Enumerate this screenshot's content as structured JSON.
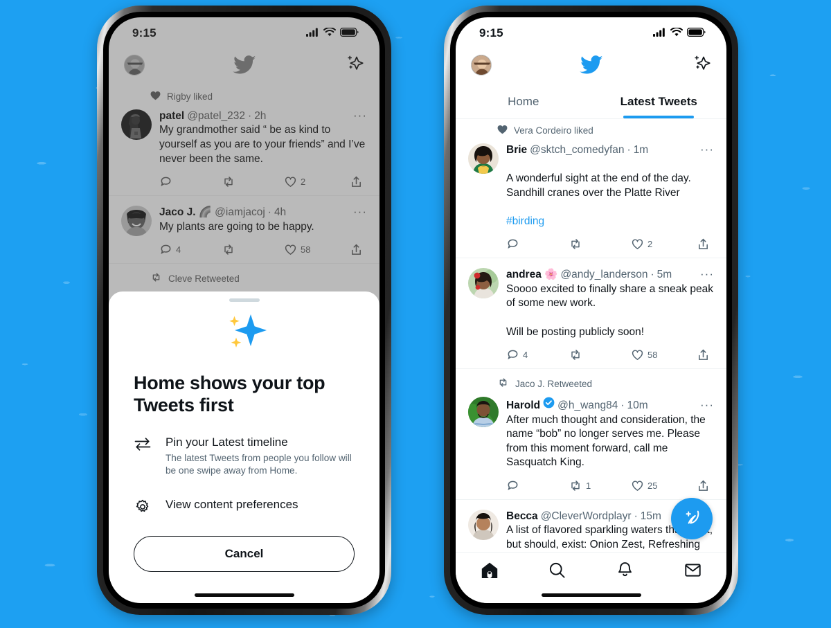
{
  "background": {
    "color": "#1DA0F2"
  },
  "phone_left": {
    "status_bar": {
      "time": "9:15",
      "icons": [
        "cellular-signal-icon",
        "wifi-icon",
        "battery-icon"
      ]
    },
    "app_bar": {
      "avatar": "profile-avatar",
      "logo": "twitter-bird-logo",
      "action": "sparkle-icon"
    },
    "timeline": [
      {
        "context_icon": "heart-filled-icon",
        "context": "Rigby liked",
        "name": "patel",
        "handle": "@patel_232",
        "separator": "·",
        "time": "2h",
        "text": "My grandmother said “ be as kind to yourself as you are to your friends” and I’ve never been the same.",
        "reply": "",
        "retweet": "",
        "like": "2",
        "more": "···"
      },
      {
        "context_icon": "",
        "context": "",
        "name": "Jaco J. 🌈",
        "handle": "@iamjacoj",
        "separator": "·",
        "time": "4h",
        "text": "My plants are going to be happy.",
        "reply": "4",
        "retweet": "",
        "like": "58",
        "more": "···"
      }
    ],
    "partial_context": {
      "icon": "retweet-icon",
      "label": "Cleve Retweeted"
    },
    "sheet": {
      "illustration": "sparkles-illustration",
      "title": "Home shows your top Tweets first",
      "rows": [
        {
          "icon": "swap-arrows-icon",
          "title": "Pin your Latest timeline",
          "subtitle": "The latest Tweets from people you follow will be one swipe away from Home."
        },
        {
          "icon": "gear-icon",
          "title": "View content preferences",
          "subtitle": ""
        }
      ],
      "cancel_label": "Cancel"
    }
  },
  "phone_right": {
    "status_bar": {
      "time": "9:15",
      "icons": [
        "cellular-signal-icon",
        "wifi-icon",
        "battery-icon"
      ]
    },
    "app_bar": {
      "avatar": "profile-avatar",
      "logo": "twitter-bird-logo",
      "action": "sparkle-icon"
    },
    "tabs": [
      {
        "label": "Home",
        "active": false
      },
      {
        "label": "Latest Tweets",
        "active": true
      }
    ],
    "accent_color": "#1D9BF0",
    "timeline": [
      {
        "context_icon": "heart-filled-icon",
        "context": "Vera Cordeiro liked",
        "name": "Brie",
        "verified": false,
        "handle": "@sktch_comedyfan",
        "separator": "·",
        "time": "1m",
        "text": "A wonderful sight at the end of the day. Sandhill cranes over the Platte River ",
        "hashtag": "#birding",
        "reply": "",
        "retweet": "",
        "like": "2",
        "more": "···"
      },
      {
        "context_icon": "",
        "context": "",
        "name": "andrea 🌸",
        "verified": false,
        "handle": "@andy_landerson",
        "separator": "·",
        "time": "5m",
        "text": "Soooo excited to finally share a sneak peak of some new work.\n\nWill be posting publicly soon!",
        "hashtag": "",
        "reply": "4",
        "retweet": "",
        "like": "58",
        "more": "···"
      },
      {
        "context_icon": "retweet-icon",
        "context": "Jaco J. Retweeted",
        "name": "Harold",
        "verified": true,
        "handle": "@h_wang84",
        "separator": "·",
        "time": "10m",
        "text": "After much thought and consideration, the name  “bob” no longer serves me. Please from this moment forward, call me Sasquatch King.",
        "hashtag": "",
        "reply": "",
        "retweet": "1",
        "like": "25",
        "more": "···"
      },
      {
        "context_icon": "",
        "context": "",
        "name": "Becca",
        "verified": false,
        "handle": "@CleverWordplayr",
        "separator": "·",
        "time": "15m",
        "text": "A list of flavored sparkling waters that don’t, but should, exist: Onion Zest, Refreshing Raisin, Totally Thyme, and",
        "hashtag": "",
        "reply": "",
        "retweet": "",
        "like": "",
        "more": "···"
      }
    ],
    "compose_fab": "compose-tweet-icon",
    "bottom_nav": [
      {
        "icon": "home-icon",
        "active": true
      },
      {
        "icon": "search-icon",
        "active": false
      },
      {
        "icon": "notifications-bell-icon",
        "active": false
      },
      {
        "icon": "messages-envelope-icon",
        "active": false
      }
    ]
  }
}
